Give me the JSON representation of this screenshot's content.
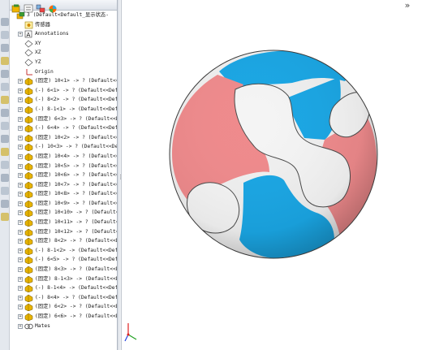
{
  "feature_tree": {
    "items": [
      {
        "prefix": "",
        "label": "3 (Default<Default_显示状态-",
        "icon": "assembly-icon",
        "expander": false,
        "level": 0
      },
      {
        "prefix": "",
        "label": "传感器",
        "icon": "sensor-icon",
        "expander": false,
        "level": 1
      },
      {
        "prefix": "",
        "label": "Annotations",
        "icon": "annotation-icon",
        "expander": true,
        "level": 1
      },
      {
        "prefix": "",
        "label": "XY",
        "icon": "plane-icon",
        "expander": false,
        "level": 1
      },
      {
        "prefix": "",
        "label": "XZ",
        "icon": "plane-icon",
        "expander": false,
        "level": 1
      },
      {
        "prefix": "",
        "label": "YZ",
        "icon": "plane-icon",
        "expander": false,
        "level": 1
      },
      {
        "prefix": "",
        "label": "Origin",
        "icon": "origin-icon",
        "expander": false,
        "level": 1
      },
      {
        "prefix": "(固定)",
        "label": "10<1> -> ? (Default<<Default",
        "icon": "part-icon",
        "expander": true,
        "level": 1
      },
      {
        "prefix": "(-)",
        "label": "6<1> -> ? (Default<<Default",
        "icon": "part-icon",
        "expander": true,
        "level": 1
      },
      {
        "prefix": "(-)",
        "label": "8<2> -> ? (Default<<Defau",
        "icon": "part-icon",
        "expander": true,
        "level": 1
      },
      {
        "prefix": "(-)",
        "label": "8-1<1> -> (Default<<Defa",
        "icon": "part-icon",
        "expander": true,
        "level": 1
      },
      {
        "prefix": "(固定)",
        "label": "6<3> -> ? (Default<<Defa",
        "icon": "part-icon",
        "expander": true,
        "level": 1
      },
      {
        "prefix": "(-)",
        "label": "6<4> -> ? (Default<<Defa",
        "icon": "part-icon",
        "expander": true,
        "level": 1
      },
      {
        "prefix": "(固定)",
        "label": "10<2> -> ? (Default<<Defa",
        "icon": "part-icon",
        "expander": true,
        "level": 1
      },
      {
        "prefix": "(-)",
        "label": "10<3> -> ? (Default<<Defa",
        "icon": "part-icon",
        "expander": true,
        "level": 1
      },
      {
        "prefix": "(固定)",
        "label": "10<4> -> ? (Default<<Defa",
        "icon": "part-icon",
        "expander": true,
        "level": 1
      },
      {
        "prefix": "(固定)",
        "label": "10<5> -> ? (Default<<Defa",
        "icon": "part-icon",
        "expander": true,
        "level": 1
      },
      {
        "prefix": "(固定)",
        "label": "10<6> -> ? (Default<<Defa",
        "icon": "part-icon",
        "expander": true,
        "level": 1
      },
      {
        "prefix": "(固定)",
        "label": "10<7> -> ? (Default<<Defa",
        "icon": "part-icon",
        "expander": true,
        "level": 1
      },
      {
        "prefix": "(固定)",
        "label": "10<8> -> ? (Default<<Defa",
        "icon": "part-icon",
        "expander": true,
        "level": 1
      },
      {
        "prefix": "(固定)",
        "label": "10<9> -> ? (Default<<Defa",
        "icon": "part-icon",
        "expander": true,
        "level": 1
      },
      {
        "prefix": "(固定)",
        "label": "10<10> -> ? (Default<<Def",
        "icon": "part-icon",
        "expander": true,
        "level": 1
      },
      {
        "prefix": "(固定)",
        "label": "10<11> -> ? (Default<<Def",
        "icon": "part-icon",
        "expander": true,
        "level": 1
      },
      {
        "prefix": "(固定)",
        "label": "10<12> -> ? (Default<<Def",
        "icon": "part-icon",
        "expander": true,
        "level": 1
      },
      {
        "prefix": "(固定)",
        "label": "8<2> -> ? (Default<<Defa",
        "icon": "part-icon",
        "expander": true,
        "level": 1
      },
      {
        "prefix": "(-)",
        "label": "8-1<2> -> (Default<<Defa",
        "icon": "part-icon",
        "expander": true,
        "level": 1
      },
      {
        "prefix": "(-)",
        "label": "6<5> -> ? (Default<<Defa",
        "icon": "part-icon",
        "expander": true,
        "level": 1
      },
      {
        "prefix": "(固定)",
        "label": "8<3> -> ? (Default<<Defa",
        "icon": "part-icon",
        "expander": true,
        "level": 1
      },
      {
        "prefix": "(固定)",
        "label": "8-1<3> -> (Default<<Defa",
        "icon": "part-icon",
        "expander": true,
        "level": 1
      },
      {
        "prefix": "(-)",
        "label": "8-1<4> -> (Default<<Defa",
        "icon": "part-icon",
        "expander": true,
        "level": 1
      },
      {
        "prefix": "(-)",
        "label": "8<4> -> ? (Default<<Defa",
        "icon": "part-icon",
        "expander": true,
        "level": 1
      },
      {
        "prefix": "(固定)",
        "label": "6<2> -> ? (Default<<Defa",
        "icon": "part-icon",
        "expander": true,
        "level": 1
      },
      {
        "prefix": "(固定)",
        "label": "6<6> -> ? (Default<<Defa",
        "icon": "part-icon",
        "expander": true,
        "level": 1
      },
      {
        "prefix": "",
        "label": "Mates",
        "icon": "mates-icon",
        "expander": true,
        "level": 1
      }
    ]
  },
  "graphics": {
    "expand_glyph": "»",
    "model_colors": {
      "blue": "#1aa6e4",
      "blue_shadow": "#0c7fb5",
      "red": "#ef8a8c",
      "red_shadow": "#cf5e63",
      "white": "#f2f2f2",
      "edge": "#3a3a3a"
    }
  },
  "colors": {
    "panel_border": "#aeb6c1",
    "tree_text": "#1b1b1b",
    "part_icon": "#e8b400"
  }
}
